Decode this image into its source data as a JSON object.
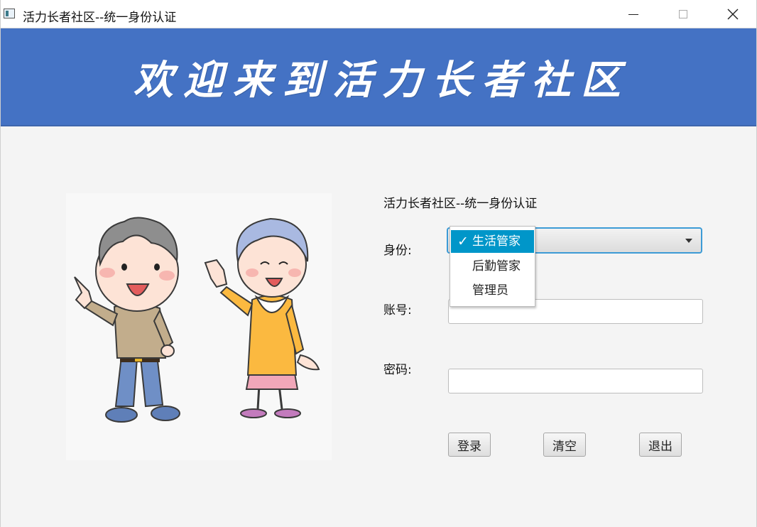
{
  "window": {
    "title": "活力长者社区--统一身份认证",
    "controls": {
      "minimize": "minimize-icon",
      "maximize": "maximize-icon",
      "close": "close-icon"
    }
  },
  "banner": {
    "text": "欢迎来到活力长者社区",
    "color": "#4472c4"
  },
  "form": {
    "heading": "活力长者社区--统一身份认证",
    "identity_label": "身份:",
    "account_label": "账号:",
    "password_label": "密码:",
    "identity_options": [
      "生活管家",
      "后勤管家",
      "管理员"
    ],
    "identity_selected": "生活管家",
    "account_value": "",
    "password_value": ""
  },
  "buttons": {
    "login": "登录",
    "clear": "清空",
    "exit": "退出"
  },
  "colors": {
    "selection": "#0096c9",
    "focus_border": "#3c9bd6"
  }
}
